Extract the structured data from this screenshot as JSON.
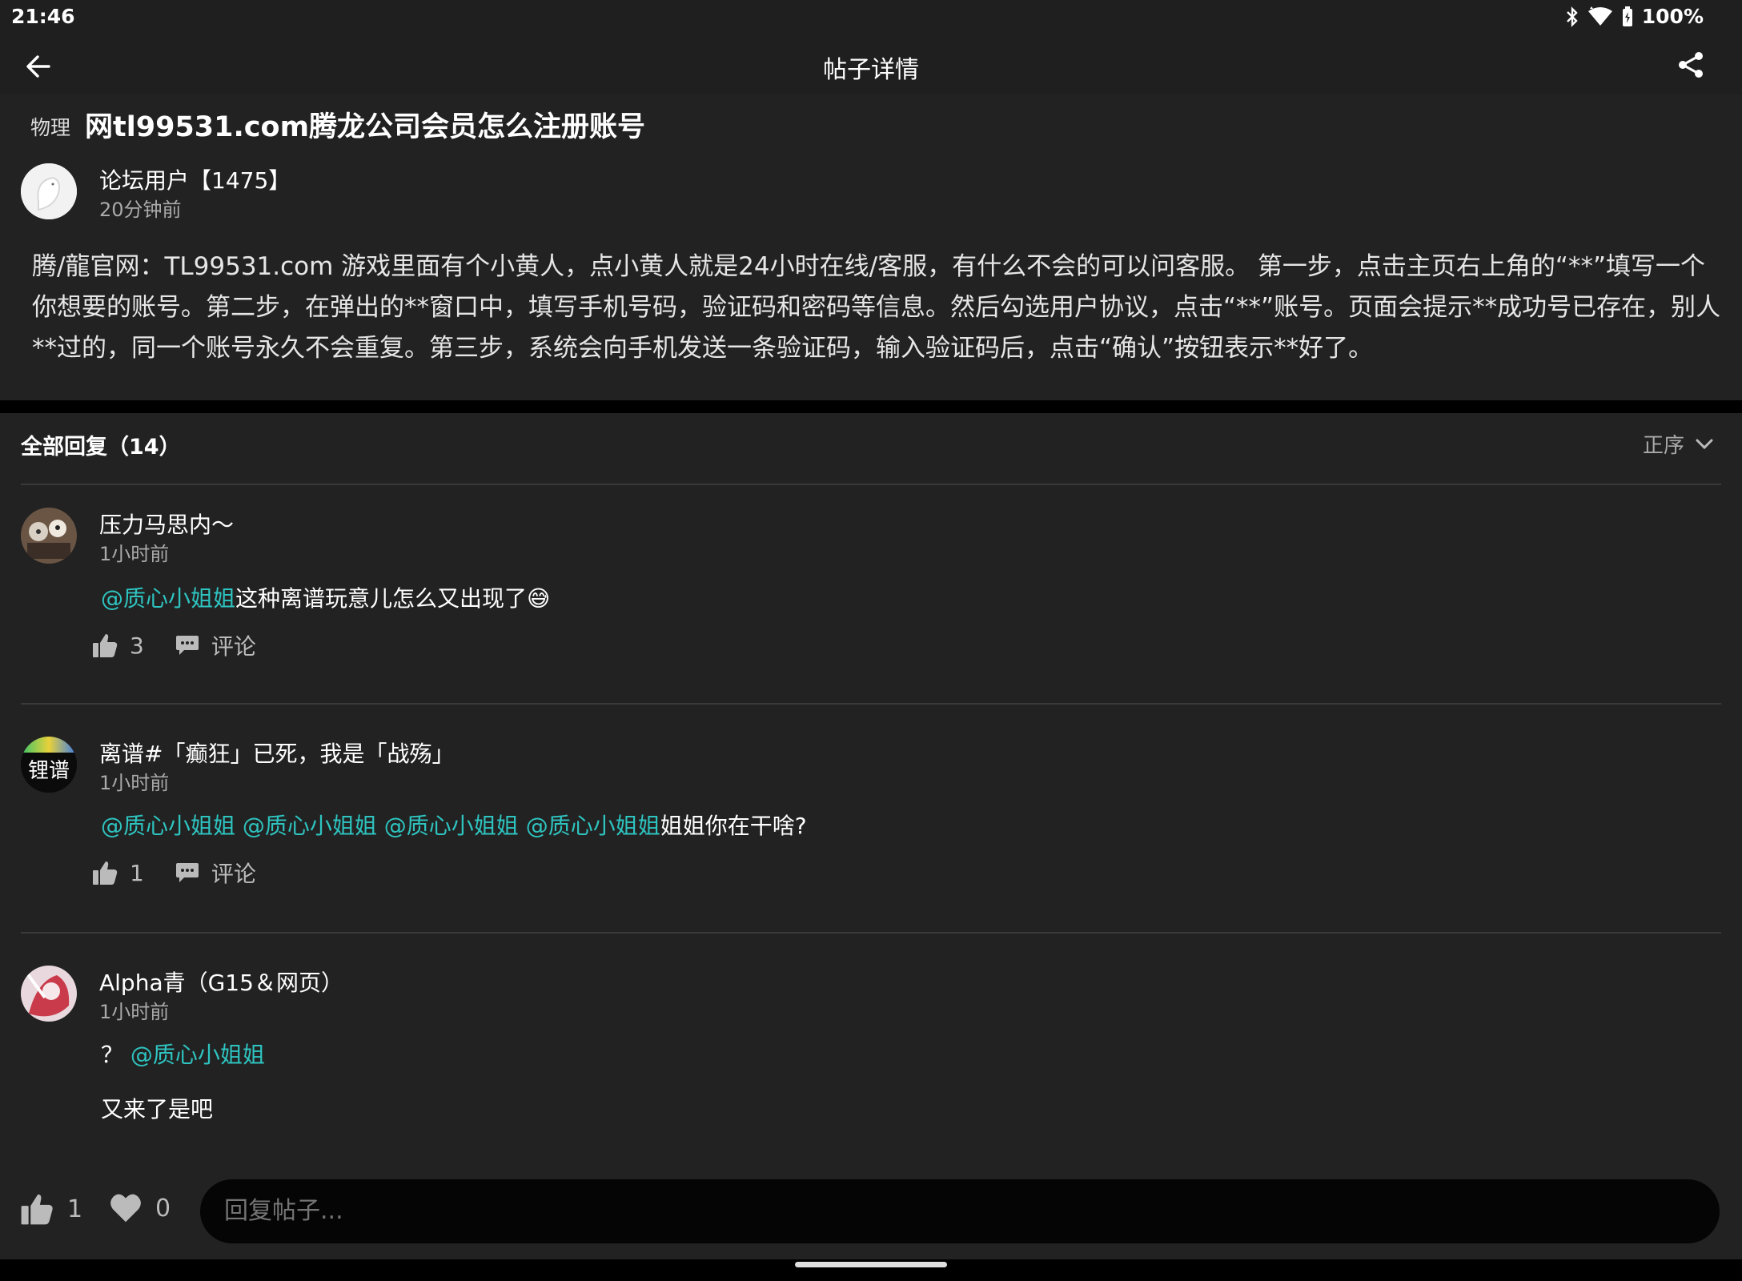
{
  "status_bar": {
    "time": "21:46",
    "battery": "100%",
    "icons": [
      "bluetooth-icon",
      "wifi-icon",
      "battery-icon"
    ]
  },
  "app_bar": {
    "title": "帖子详情",
    "back_icon": "arrow-left-icon",
    "share_icon": "share-icon"
  },
  "post": {
    "tag": "物理",
    "title": "网tl99531.com腾龙公司会员怎么注册账号",
    "author": "论坛用户【1475】",
    "time": "20分钟前",
    "body": "腾/龍官网：TL99531.com  游戏里面有个小黄人，点小黄人就是24小时在线/客服，有什么不会的可以问客服。 第一步，点击主页右上角的“**”填写一个你想要的账号。第二步，在弹出的**窗口中，填写手机号码，验证码和密码等信息。然后勾选用户协议，点击“**”账号。页面会提示**成功号已存在，别人**过的，同一个账号永久不会重复。第三步，系统会向手机发送一条验证码，输入验证码后，点击“确认”按钮表示**好了。"
  },
  "replies": {
    "header": "全部回复（14）",
    "sort_label": "正序",
    "comment_label": "评论",
    "items": [
      {
        "name": "压力马思内～",
        "time": "1小时前",
        "mention": "@质心小姐姐",
        "text": "这种离谱玩意儿怎么又出现了😅",
        "likes": "3"
      },
      {
        "name": "离谱#「癫狂」已死，我是「战殇」",
        "avatar_text": "锂谱",
        "time": "1小时前",
        "mentions": "@质心小姐姐 @质心小姐姐 @质心小姐姐 @质心小姐姐",
        "text": "姐姐你在干啥?",
        "likes": "1"
      },
      {
        "name": "Alpha青（G15＆网页）",
        "time": "1小时前",
        "prefix": "？",
        "mention": "@质心小姐姐",
        "text2": "又来了是吧"
      }
    ]
  },
  "bottom_bar": {
    "likes": "1",
    "hearts": "0",
    "reply_placeholder": "回复帖子..."
  },
  "colors": {
    "background": "#222222",
    "mention": "#2ec4c0",
    "status_bar": "#1f1f1f"
  }
}
